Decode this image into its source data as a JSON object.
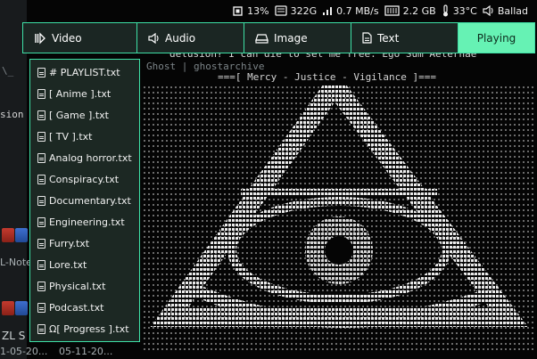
{
  "status_bar": {
    "cpu": "13%",
    "disk": "322G",
    "network": "0.7 MB/s",
    "memory": "2.2 GB",
    "temperature": "33°C",
    "track": "Ballad"
  },
  "menu": {
    "tabs": [
      {
        "label": "Video",
        "icon": "video-icon"
      },
      {
        "label": "Audio",
        "icon": "speaker-icon"
      },
      {
        "label": "Image",
        "icon": "drive-icon"
      },
      {
        "label": "Text",
        "icon": "document-icon"
      },
      {
        "label": "Playing",
        "icon": "",
        "active": true
      }
    ]
  },
  "dropdown": {
    "items": [
      "# PLAYLIST.txt",
      "[ Anime ].txt",
      "[ Game ].txt",
      "[ TV ].txt",
      "Analog horror.txt",
      "Conspiracy.txt",
      "Documentary.txt",
      "Engineering.txt",
      "Furry.txt",
      "Lore.txt",
      "Physical.txt",
      "Podcast.txt",
      "Ω[ Progress ].txt"
    ]
  },
  "terminal": {
    "line1": "delusion? I can die to set me free. Ego Sum Aeternae",
    "line2": "Ghost | ghostarchive",
    "line3": "===[ Mercy - Justice - Vigilance ]===",
    "side_text_1": "sion",
    "side_text_2": "L-Note",
    "side_text_3": "ZL S",
    "date_1": "1-05-20...",
    "date_2": "05-11-20..."
  },
  "colors": {
    "accent": "#3ee0a6",
    "menu_bg": "#1b2623",
    "playing_bg": "#66f2b4"
  }
}
